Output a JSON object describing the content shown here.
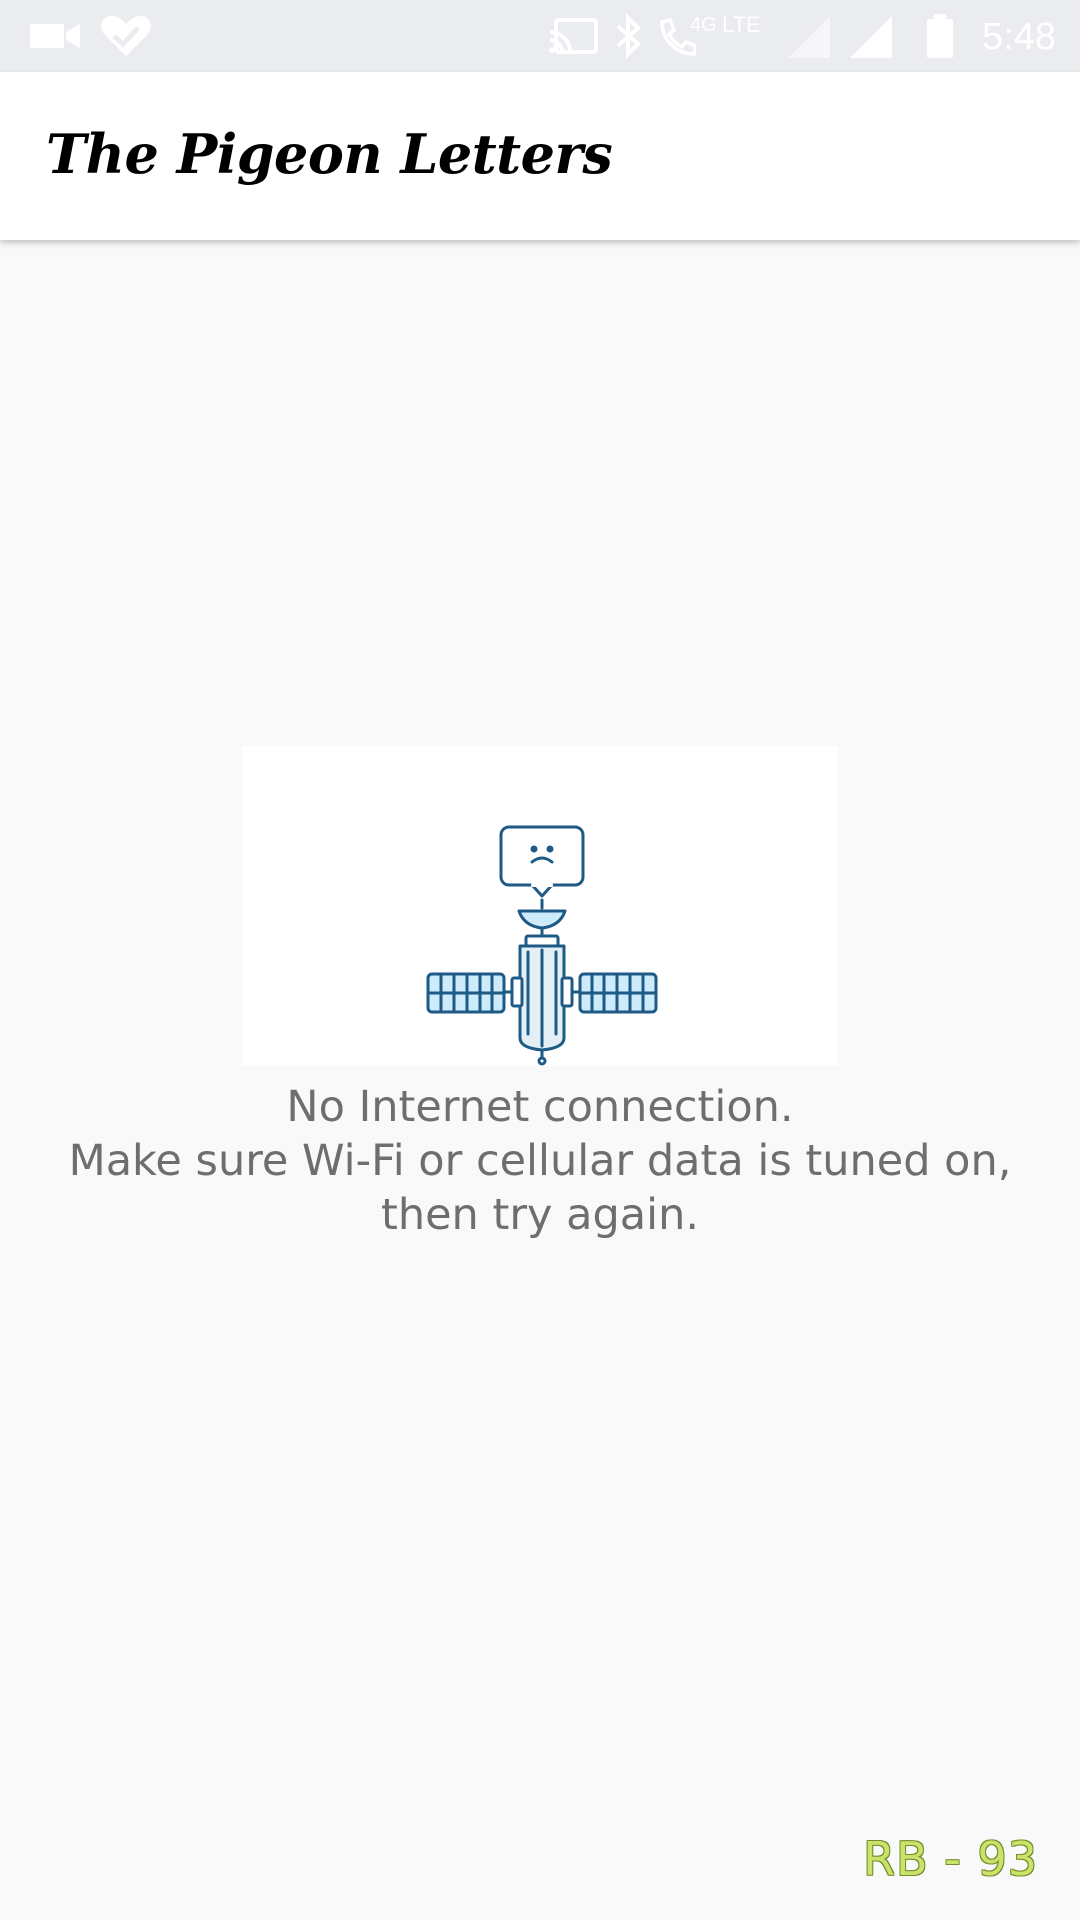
{
  "status_bar": {
    "time": "5:48",
    "icons": [
      "video-camera-icon",
      "heart-check-icon",
      "cast-icon",
      "bluetooth-icon",
      "wifi-call-icon",
      "lte-icon",
      "signal-weak-icon",
      "signal-icon",
      "battery-icon"
    ],
    "network_labels": [
      "4G",
      "LTE"
    ]
  },
  "app_bar": {
    "title": "The Pigeon Letters"
  },
  "error": {
    "illustration": "satellite-sad-icon",
    "line1": "No Internet connection.",
    "line2": "Make sure Wi-Fi or cellular data is tuned on,",
    "line3": "then try again."
  },
  "watermark": "RB - 93",
  "colors": {
    "background": "#f9f9f9",
    "status_bar": "#eaecef",
    "message_text": "#6e6e6e",
    "illustration_stroke": "#1d5a85",
    "illustration_fill": "#cdebfa"
  }
}
